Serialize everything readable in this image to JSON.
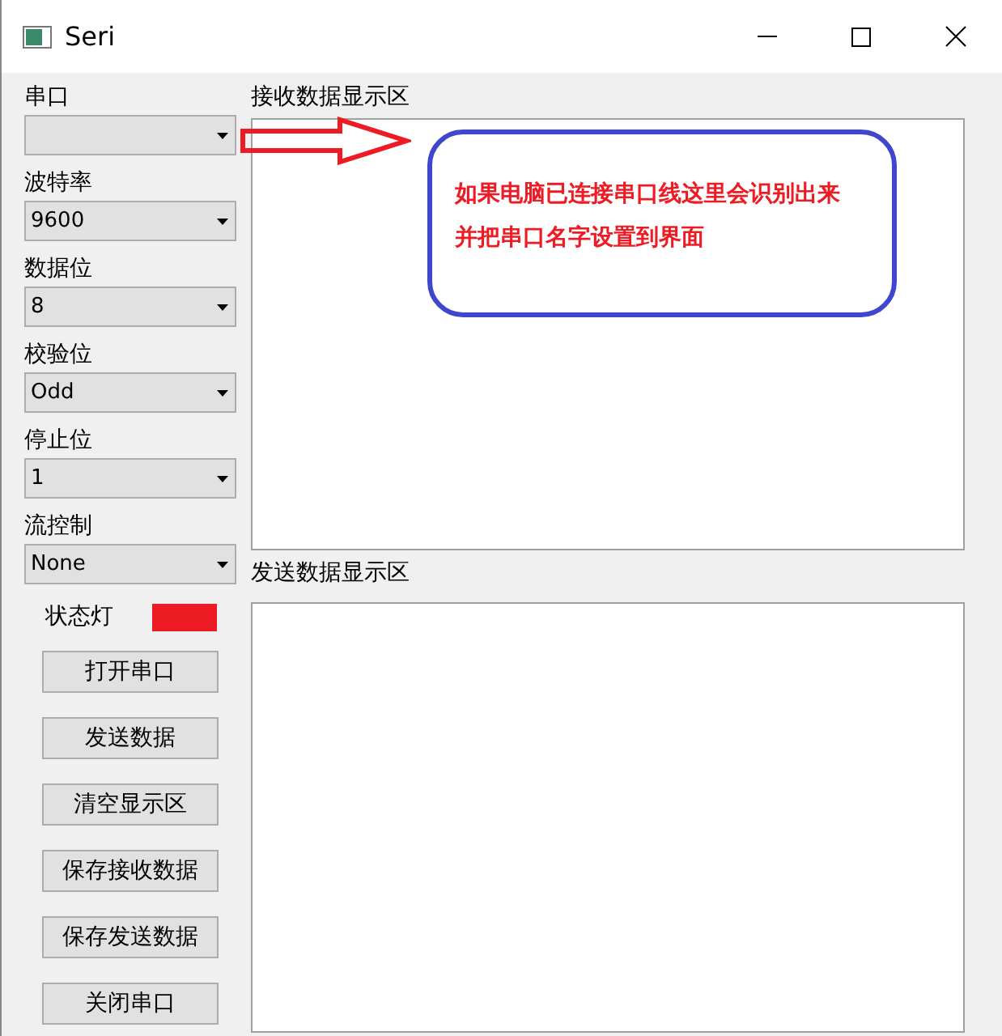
{
  "window": {
    "title": "Seri"
  },
  "settings": [
    {
      "label": "串口"
    },
    {
      "label": "波特率",
      "value": "9600"
    },
    {
      "label": "数据位",
      "value": "8"
    },
    {
      "label": "校验位",
      "value": "Odd"
    },
    {
      "label": "停止位",
      "value": "1"
    },
    {
      "label": "流控制",
      "value": "None"
    }
  ],
  "status_light": {
    "label": "状态灯",
    "color": "#ed1c24"
  },
  "buttons": [
    "打开串口",
    "发送数据",
    "清空显示区",
    "保存接收数据",
    "保存发送数据",
    "关闭串口"
  ],
  "receive_area": {
    "label": "接收数据显示区"
  },
  "send_area": {
    "label": "发送数据显示区"
  },
  "annotation": {
    "lines": [
      "如果电脑已连接串口线这里会识别出来",
      "并把串口名字设置到界面"
    ]
  }
}
